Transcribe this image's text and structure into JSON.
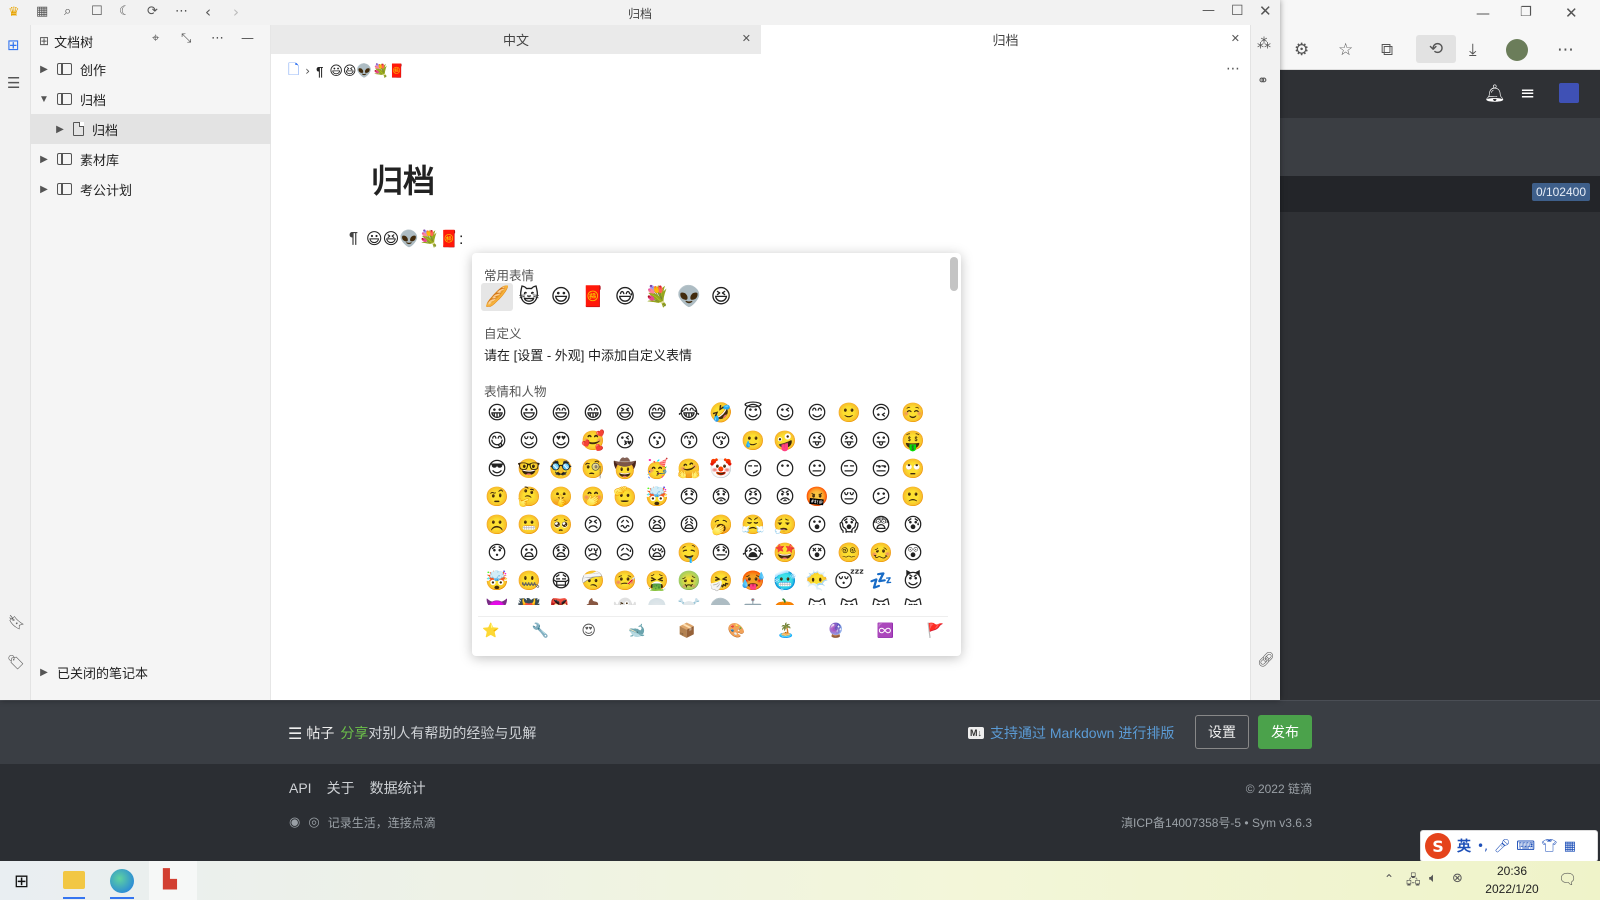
{
  "window": {
    "title": "归档"
  },
  "tabs": [
    {
      "label": "中文"
    },
    {
      "label": "归档"
    }
  ],
  "tree": {
    "header": "文档树",
    "items": [
      {
        "label": "创作"
      },
      {
        "label": "归档"
      },
      {
        "label": "归档"
      },
      {
        "label": "素材库"
      },
      {
        "label": "考公计划"
      }
    ],
    "closed_notebooks": "已关闭的笔记本"
  },
  "breadcrumb": {
    "pilcrow": "¶",
    "emojis": "😃😆👽💐🧧"
  },
  "editor": {
    "doc_title": "归档",
    "paragraph_mark": "¶",
    "paragraph_emojis": "😃😆👽💐🧧",
    "paragraph_suffix": ":"
  },
  "emoji_panel": {
    "sections": {
      "frequent": "常用表情",
      "custom": "自定义",
      "custom_hint": "请在 [设置 - 外观] 中添加自定义表情",
      "people": "表情和人物"
    },
    "frequent_emojis": [
      "🥖",
      "😺",
      "😃",
      "🧧",
      "😅",
      "💐",
      "👽",
      "😆"
    ],
    "people_emojis": [
      "😀",
      "😃",
      "😄",
      "😁",
      "😆",
      "😅",
      "😂",
      "🤣",
      "😇",
      "😉",
      "😊",
      "🙂",
      "🙃",
      "☺️",
      "😋",
      "😌",
      "😍",
      "🥰",
      "😘",
      "😗",
      "😙",
      "😚",
      "🥲",
      "🤪",
      "😜",
      "😝",
      "😛",
      "🤑",
      "😎",
      "🤓",
      "🥸",
      "🧐",
      "🤠",
      "🥳",
      "🤗",
      "🤡",
      "😏",
      "😶",
      "😐",
      "😑",
      "😒",
      "🙄",
      "🤨",
      "🤔",
      "🤫",
      "🤭",
      "🫡",
      "🤯",
      "😞",
      "😟",
      "😠",
      "😡",
      "🤬",
      "😔",
      "😕",
      "🙁",
      "☹️",
      "😬",
      "🥺",
      "😣",
      "😖",
      "😫",
      "😩",
      "🥱",
      "😤",
      "😮‍💨",
      "😮",
      "😱",
      "😨",
      "😰",
      "😯",
      "😦",
      "😧",
      "😢",
      "😥",
      "😪",
      "🤤",
      "😓",
      "😭",
      "🤩",
      "😵",
      "😵‍💫",
      "🥴",
      "😲",
      "🤯",
      "🤐",
      "😷",
      "🤕",
      "🤒",
      "🤮",
      "🤢",
      "🤧",
      "🥵",
      "🥶",
      "😶‍🌫️",
      "😴",
      "💤",
      "😈",
      "👿",
      "👹",
      "👺",
      "💩",
      "👻",
      "💀",
      "☠️",
      "👽",
      "🤖",
      "🎃",
      "😺",
      "😸",
      "😹",
      "😻"
    ],
    "category_icons": [
      "⭐",
      "🔧",
      "😍",
      "🐋",
      "📦",
      "🎨",
      "🏝️",
      "🔮",
      "♾️",
      "🚩"
    ]
  },
  "browser": {
    "counter": "0/102400"
  },
  "post_bar": {
    "title": "帖子",
    "share_word": "分享",
    "share_desc": "对别人有帮助的经验与见解",
    "markdown_badge": "M↓",
    "markdown_link": "支持通过 Markdown 进行排版",
    "settings_button": "设置",
    "publish_button": "发布"
  },
  "footer": {
    "links": [
      "API",
      "关于",
      "数据统计"
    ],
    "slogan": "记录生活，连接点滴",
    "copyright": "© 2022 链滴",
    "icp": "滇ICP备14007358号-5 • Sym v3.6.3"
  },
  "ime": {
    "mode": "英"
  },
  "taskbar": {
    "time": "20:36",
    "date": "2022/1/20"
  }
}
